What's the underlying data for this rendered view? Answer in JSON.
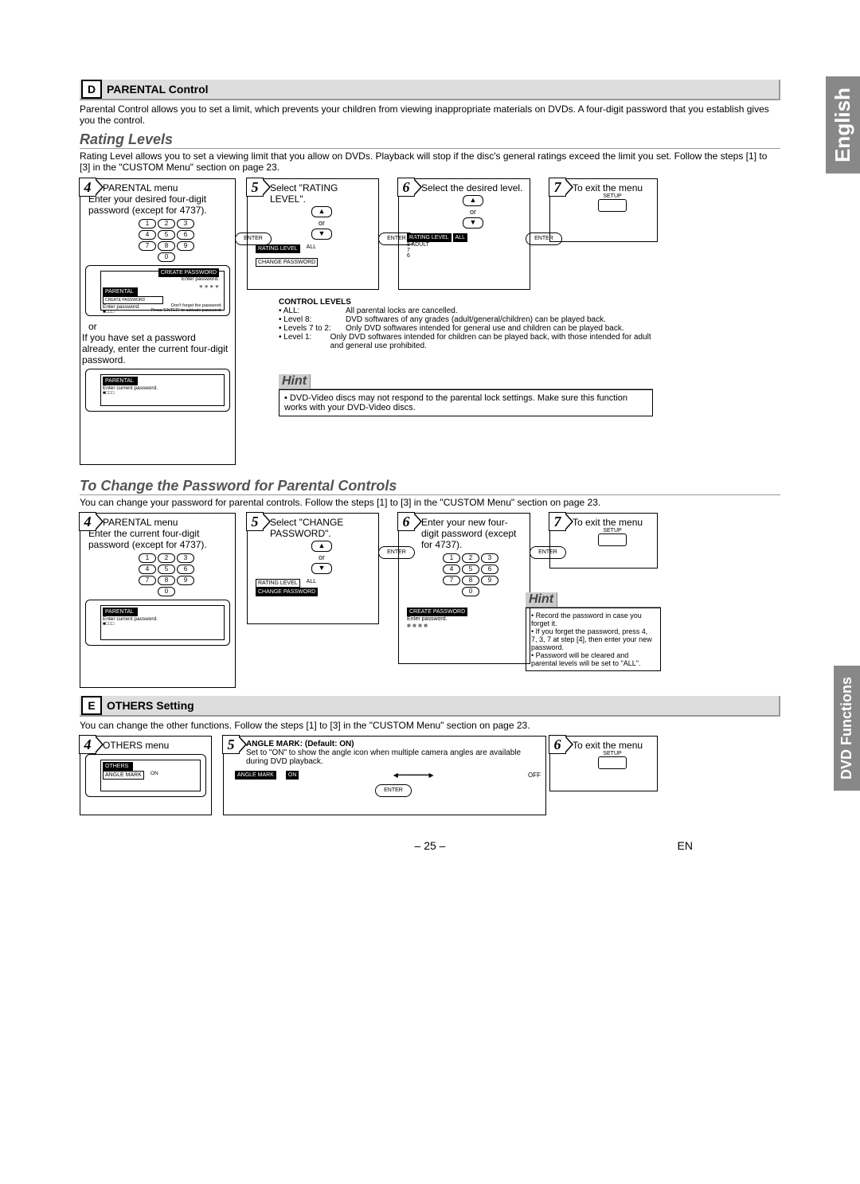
{
  "side": {
    "english": "English",
    "dvd": "DVD Functions"
  },
  "secD": {
    "letter": "D",
    "title": "PARENTAL Control",
    "intro": "Parental Control allows you to set a limit, which prevents your children from viewing inappropriate materials on DVDs. A four-digit password that you establish gives you the control."
  },
  "rating": {
    "heading": "Rating Levels",
    "intro": "Rating Level allows you to set a viewing limit that you allow on DVDs. Playback will stop if the disc's general ratings exceed the limit you set. Follow the steps [1] to [3] in the \"CUSTOM Menu\" section on page 23.",
    "step4": {
      "num": "4",
      "title": "PARENTAL menu",
      "line1": "Enter your desired four-digit password (except for 4737).",
      "or": "or",
      "alt": "If you have set a password already, enter the current four-digit password.",
      "osd1": {
        "tab": "PARENTAL",
        "a": "CREATE PASSWORD",
        "b": "Enter password.",
        "c": "Don't forget the password.",
        "d": "Press 'ENTER' to activate password."
      },
      "osd2": {
        "tab": "PARENTAL",
        "a": "Enter current password."
      }
    },
    "step5": {
      "num": "5",
      "line": "Select \"RATING LEVEL\".",
      "or": "or",
      "osd": {
        "a": "RATING LEVEL",
        "aval": "ALL",
        "b": "CHANGE PASSWORD"
      }
    },
    "step6": {
      "num": "6",
      "line": "Select the desired level.",
      "or": "or",
      "osd": {
        "a": "RATING LEVEL",
        "l1": "ALL",
        "l2": "8  ADULT",
        "l3": "7",
        "l4": "6"
      }
    },
    "step7": {
      "num": "7",
      "line": "To exit the menu",
      "setup": "SETUP"
    },
    "enter": "ENTER",
    "ctrl": {
      "heading": "CONTROL LEVELS",
      "rows": [
        {
          "k": "• ALL:",
          "v": "All parental locks are cancelled."
        },
        {
          "k": "• Level 8:",
          "v": "DVD softwares of any grades (adult/general/children) can be played back."
        },
        {
          "k": "• Levels 7 to 2:",
          "v": "Only DVD softwares intended for general use and children can be played back."
        },
        {
          "k": "• Level 1:",
          "v": "Only DVD softwares intended for children can be played back, with those intended for adult and general use prohibited."
        }
      ]
    },
    "hint": {
      "label": "Hint",
      "text": "• DVD-Video discs may not respond to the parental lock settings. Make sure this function works with your DVD-Video discs."
    }
  },
  "change": {
    "heading": "To Change the Password for Parental Controls",
    "intro": "You can change your password for parental controls.  Follow the steps [1] to [3] in the \"CUSTOM Menu\" section on page 23.",
    "step4": {
      "num": "4",
      "title": "PARENTAL menu",
      "line1": "Enter the current four-digit password (except for 4737).",
      "osd": {
        "tab": "PARENTAL",
        "a": "Enter current password."
      }
    },
    "step5": {
      "num": "5",
      "line": "Select \"CHANGE PASSWORD\".",
      "or": "or",
      "osd": {
        "a": "RATING LEVEL",
        "aval": "ALL",
        "b": "CHANGE PASSWORD"
      }
    },
    "step6": {
      "num": "6",
      "line": "Enter your new four-digit password (except for 4737).",
      "osd": {
        "a": "CREATE PASSWORD",
        "b": "Enter password."
      }
    },
    "step7": {
      "num": "7",
      "line": "To exit the menu",
      "setup": "SETUP"
    },
    "hint": {
      "label": "Hint",
      "b1": "• Record the password in case you forget it.",
      "b2": "• If you forget the password, press 4, 7, 3, 7 at step [4], then enter your new password.",
      "b3": "• Password will be cleared and parental levels will be set to \"ALL\"."
    }
  },
  "secE": {
    "letter": "E",
    "title": "OTHERS Setting",
    "intro": "You can change the other functions. Follow the steps [1] to [3] in the \"CUSTOM Menu\" section on page 23.",
    "step4": {
      "num": "4",
      "title": "OTHERS menu",
      "osd": {
        "tab": "OTHERS",
        "a": "ANGLE MARK",
        "aval": "ON"
      }
    },
    "step5": {
      "num": "5",
      "heading": "ANGLE MARK: (Default: ON)",
      "text": "Set to \"ON\" to show the angle icon when multiple camera angles are available during DVD playback.",
      "osd": {
        "a": "ANGLE MARK",
        "on": "ON",
        "off": "OFF"
      }
    },
    "step6": {
      "num": "6",
      "line": "To exit the menu",
      "setup": "SETUP"
    }
  },
  "keypad": [
    "1",
    "2",
    "3",
    "4",
    "5",
    "6",
    "7",
    "8",
    "9",
    "0"
  ],
  "footer": {
    "page": "– 25 –",
    "lang": "EN"
  }
}
